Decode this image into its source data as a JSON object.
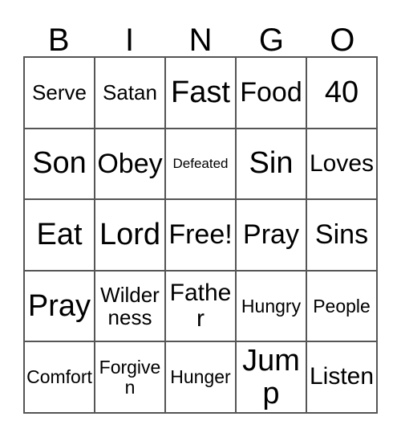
{
  "card": {
    "header_letters": [
      "B",
      "I",
      "N",
      "G",
      "O"
    ],
    "grid": [
      [
        {
          "text": "Serve",
          "size": "sm"
        },
        {
          "text": "Satan",
          "size": "sm"
        },
        {
          "text": "Fast",
          "size": "xl"
        },
        {
          "text": "Food",
          "size": "lg"
        },
        {
          "text": "40",
          "size": "xl"
        }
      ],
      [
        {
          "text": "Son",
          "size": "xl"
        },
        {
          "text": "Obey",
          "size": "lg"
        },
        {
          "text": "Defeated",
          "size": "xxs"
        },
        {
          "text": "Sin",
          "size": "xl"
        },
        {
          "text": "Loves",
          "size": "md"
        }
      ],
      [
        {
          "text": "Eat",
          "size": "xl"
        },
        {
          "text": "Lord",
          "size": "xl"
        },
        {
          "text": "Free!",
          "size": "lg"
        },
        {
          "text": "Pray",
          "size": "lg"
        },
        {
          "text": "Sins",
          "size": "lg"
        }
      ],
      [
        {
          "text": "Pray",
          "size": "xl"
        },
        {
          "text": "Wilderness",
          "size": "sm"
        },
        {
          "text": "Father",
          "size": "md"
        },
        {
          "text": "Hungry",
          "size": "xs"
        },
        {
          "text": "People",
          "size": "xs"
        }
      ],
      [
        {
          "text": "Comfort",
          "size": "xs"
        },
        {
          "text": "Forgiven",
          "size": "xs"
        },
        {
          "text": "Hunger",
          "size": "xs"
        },
        {
          "text": "Jump",
          "size": "xl"
        },
        {
          "text": "Listen",
          "size": "md"
        }
      ]
    ],
    "colors": {
      "background": "#ffffff",
      "border": "#555555",
      "text": "#000000"
    }
  }
}
